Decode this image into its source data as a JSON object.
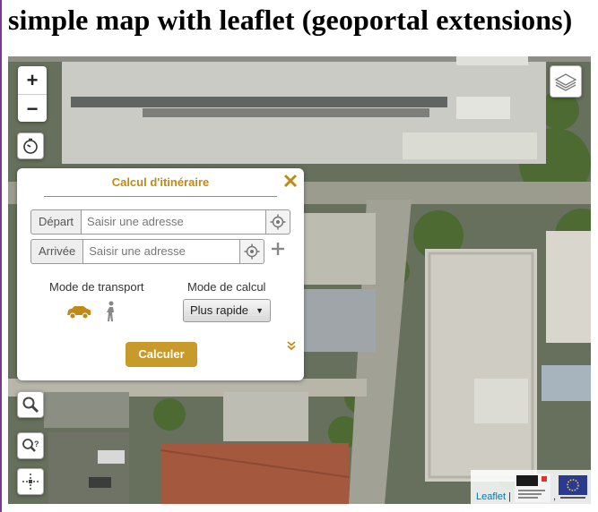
{
  "page": {
    "title": "simple map with leaflet (geoportal extensions)"
  },
  "map": {
    "zoom_in": "+",
    "zoom_out": "−",
    "attribution": {
      "link": "Leaflet",
      "separator": "|",
      "comma": ","
    }
  },
  "route_panel": {
    "title": "Calcul d'itinéraire",
    "start": {
      "label": "Départ",
      "placeholder": "Saisir une adresse"
    },
    "end": {
      "label": "Arrivée",
      "placeholder": "Saisir une adresse"
    },
    "transport_label": "Mode de transport",
    "calc_mode_label": "Mode de calcul",
    "calc_mode_value": "Plus rapide",
    "submit_label": "Calculer"
  },
  "colors": {
    "accent": "#c08a18",
    "button": "#c89a2a",
    "title_border": "#7b3b8c"
  },
  "icons": [
    "zoom-in",
    "zoom-out",
    "layers-icon",
    "clock-icon",
    "close-icon",
    "crosshair-icon",
    "plus-icon",
    "car-icon",
    "pedestrian-icon",
    "chevron-double-down-icon",
    "search-icon",
    "reverse-geocode-icon",
    "measure-icon",
    "ign-logo",
    "eu-flag-icon"
  ]
}
